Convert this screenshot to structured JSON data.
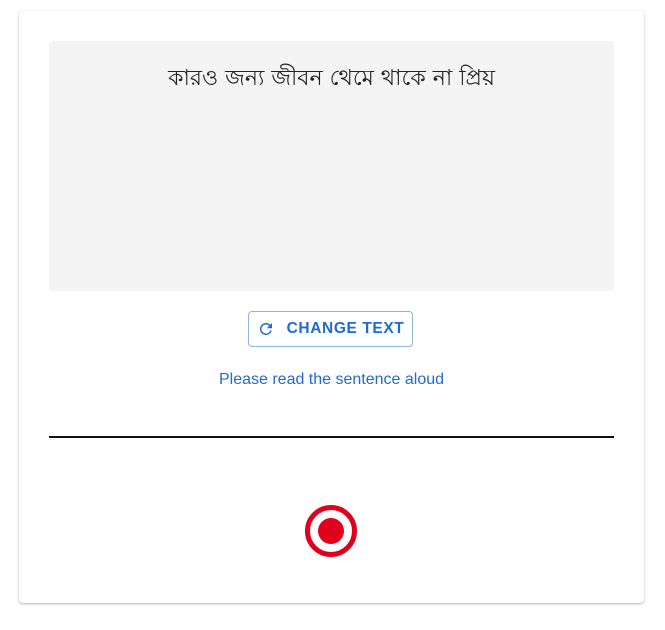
{
  "prompt": {
    "sentence": "কারও জন্য জীবন থেমে থাকে না প্রিয়"
  },
  "controls": {
    "change_text_label": "CHANGE TEXT",
    "change_text_icon": "refresh-icon",
    "instruction": "Please read the sentence aloud",
    "record_icon": "record-icon"
  },
  "colors": {
    "accent": "#1f6bd0",
    "record": "#e0001b",
    "sentence_background": "#f4f4f4"
  }
}
